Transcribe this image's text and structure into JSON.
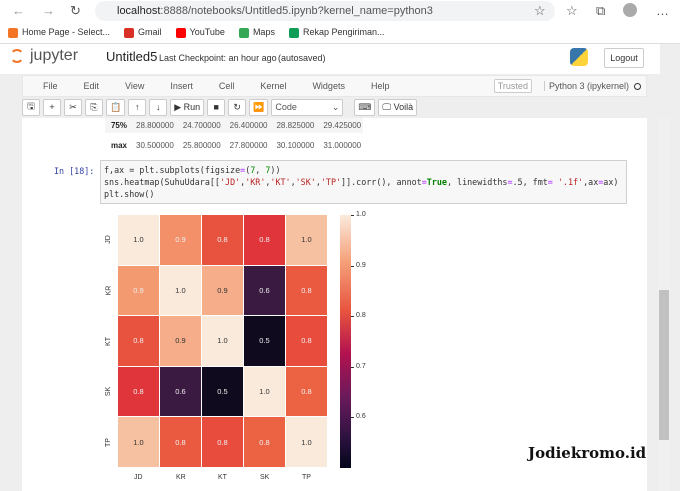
{
  "browser": {
    "url_host": "localhost",
    "url_rest": ":8888/notebooks/Untitled5.ipynb?kernel_name=python3",
    "bookmarks": [
      {
        "label": "Home Page - Select...",
        "color": "#f37626"
      },
      {
        "label": "Gmail",
        "color": "#d93025"
      },
      {
        "label": "YouTube",
        "color": "#ff0000"
      },
      {
        "label": "Maps",
        "color": "#34a853"
      },
      {
        "label": "Rekap Pengiriman...",
        "color": "#0f9d58"
      }
    ]
  },
  "jupyter": {
    "logo": "jupyter",
    "notebook_name": "Untitled5",
    "checkpoint": "Last Checkpoint: an hour ago",
    "autosave": "(autosaved)",
    "logout": "Logout",
    "menu": [
      "File",
      "Edit",
      "View",
      "Insert",
      "Cell",
      "Kernel",
      "Widgets",
      "Help"
    ],
    "trusted": "Trusted",
    "kernel": "Python 3 (ipykernel)",
    "toolbar": {
      "run": "Run",
      "cell_type": "Code",
      "voila": "Voilà"
    }
  },
  "output_table": {
    "rows": [
      {
        "label": "75%",
        "values": [
          "28.800000",
          "24.700000",
          "26.400000",
          "28.825000",
          "29.425000"
        ]
      },
      {
        "label": "max",
        "values": [
          "30.500000",
          "25.800000",
          "27.800000",
          "30.100000",
          "31.000000"
        ]
      }
    ]
  },
  "cell": {
    "prompt": "In [18]:",
    "lines": [
      "f,ax = plt.subplots(figsize=(7, 7))",
      "sns.heatmap(SuhuUdara[['JD','KR','KT','SK','TP']].corr(), annot=True, linewidths=.5, fmt= '.1f',ax=ax)",
      "plt.show()"
    ]
  },
  "chart_data": {
    "type": "heatmap",
    "labels": [
      "JD",
      "KR",
      "KT",
      "SK",
      "TP"
    ],
    "values": [
      [
        1.0,
        0.9,
        0.8,
        0.8,
        1.0
      ],
      [
        0.9,
        1.0,
        0.9,
        0.6,
        0.8
      ],
      [
        0.8,
        0.9,
        1.0,
        0.5,
        0.8
      ],
      [
        0.8,
        0.6,
        0.5,
        1.0,
        0.8
      ],
      [
        1.0,
        0.8,
        0.8,
        0.8,
        1.0
      ]
    ],
    "annotations": [
      [
        "1.0",
        "0.9",
        "0.8",
        "0.8",
        "1.0"
      ],
      [
        "0.9",
        "1.0",
        "0.9",
        "0.6",
        "0.8"
      ],
      [
        "0.8",
        "0.9",
        "1.0",
        "0.5",
        "0.8"
      ],
      [
        "0.8",
        "0.6",
        "0.5",
        "1.0",
        "0.8"
      ],
      [
        "1.0",
        "0.8",
        "0.8",
        "0.8",
        "1.0"
      ]
    ],
    "cell_colors": [
      [
        "#faeadc",
        "#f3906a",
        "#e8533f",
        "#e0353b",
        "#f6c1a0"
      ],
      [
        "#f39a70",
        "#faeadc",
        "#f5ad8a",
        "#3a1a40",
        "#ea5a40"
      ],
      [
        "#e8533f",
        "#f5ad8a",
        "#faeadc",
        "#100a1e",
        "#e84c3d"
      ],
      [
        "#e0353b",
        "#3a1a40",
        "#100a1e",
        "#faeadc",
        "#ec6344"
      ],
      [
        "#f6c1a0",
        "#ea5a40",
        "#e84c3d",
        "#ec6344",
        "#faeadc"
      ]
    ],
    "colormap": "rocket",
    "colorbar_range": [
      0.5,
      1.0
    ],
    "colorbar_ticks": [
      "1.0",
      "0.9",
      "0.8",
      "0.7",
      "0.6"
    ]
  },
  "watermark": "Jodiekromo.id"
}
